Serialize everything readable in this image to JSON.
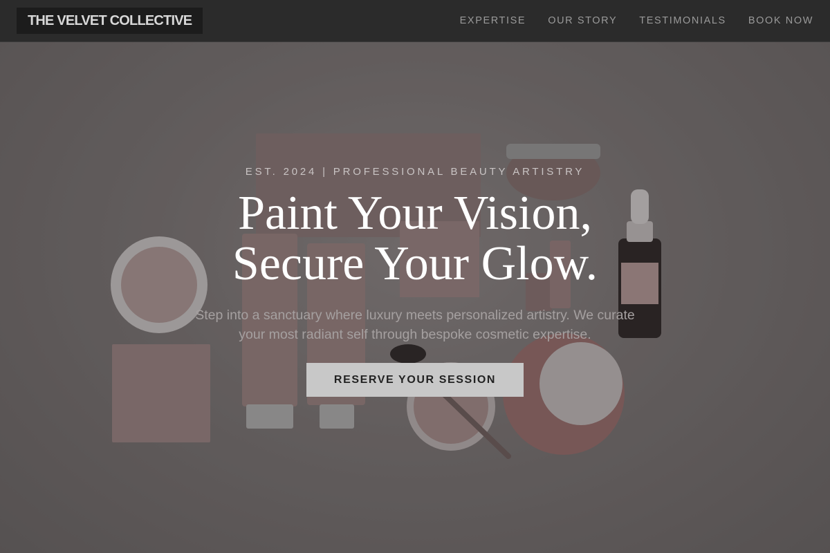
{
  "header": {
    "logo": "THE VELVET COLLECTIVE",
    "nav": [
      "EXPERTISE",
      "OUR STORY",
      "TESTIMONIALS",
      "BOOK NOW"
    ]
  },
  "hero": {
    "tagline": "EST. 2024 | PROFESSIONAL BEAUTY ARTISTRY",
    "title_line1": "Paint Your Vision,",
    "title_line2": "Secure Your Glow.",
    "subtitle_line1": "Step into a sanctuary where luxury meets personalized artistry. We curate",
    "subtitle_line2": "your most radiant self through bespoke cosmetic expertise.",
    "cta_label": "RESERVE YOUR SESSION",
    "background_image": "cosmetic-products-flatlay"
  },
  "colors": {
    "header_bg": "#2b2b2b",
    "logo_bg": "#1c1c1c",
    "accent_pink": "#c9a3a3",
    "cta_bg": "#c8c8c8"
  }
}
